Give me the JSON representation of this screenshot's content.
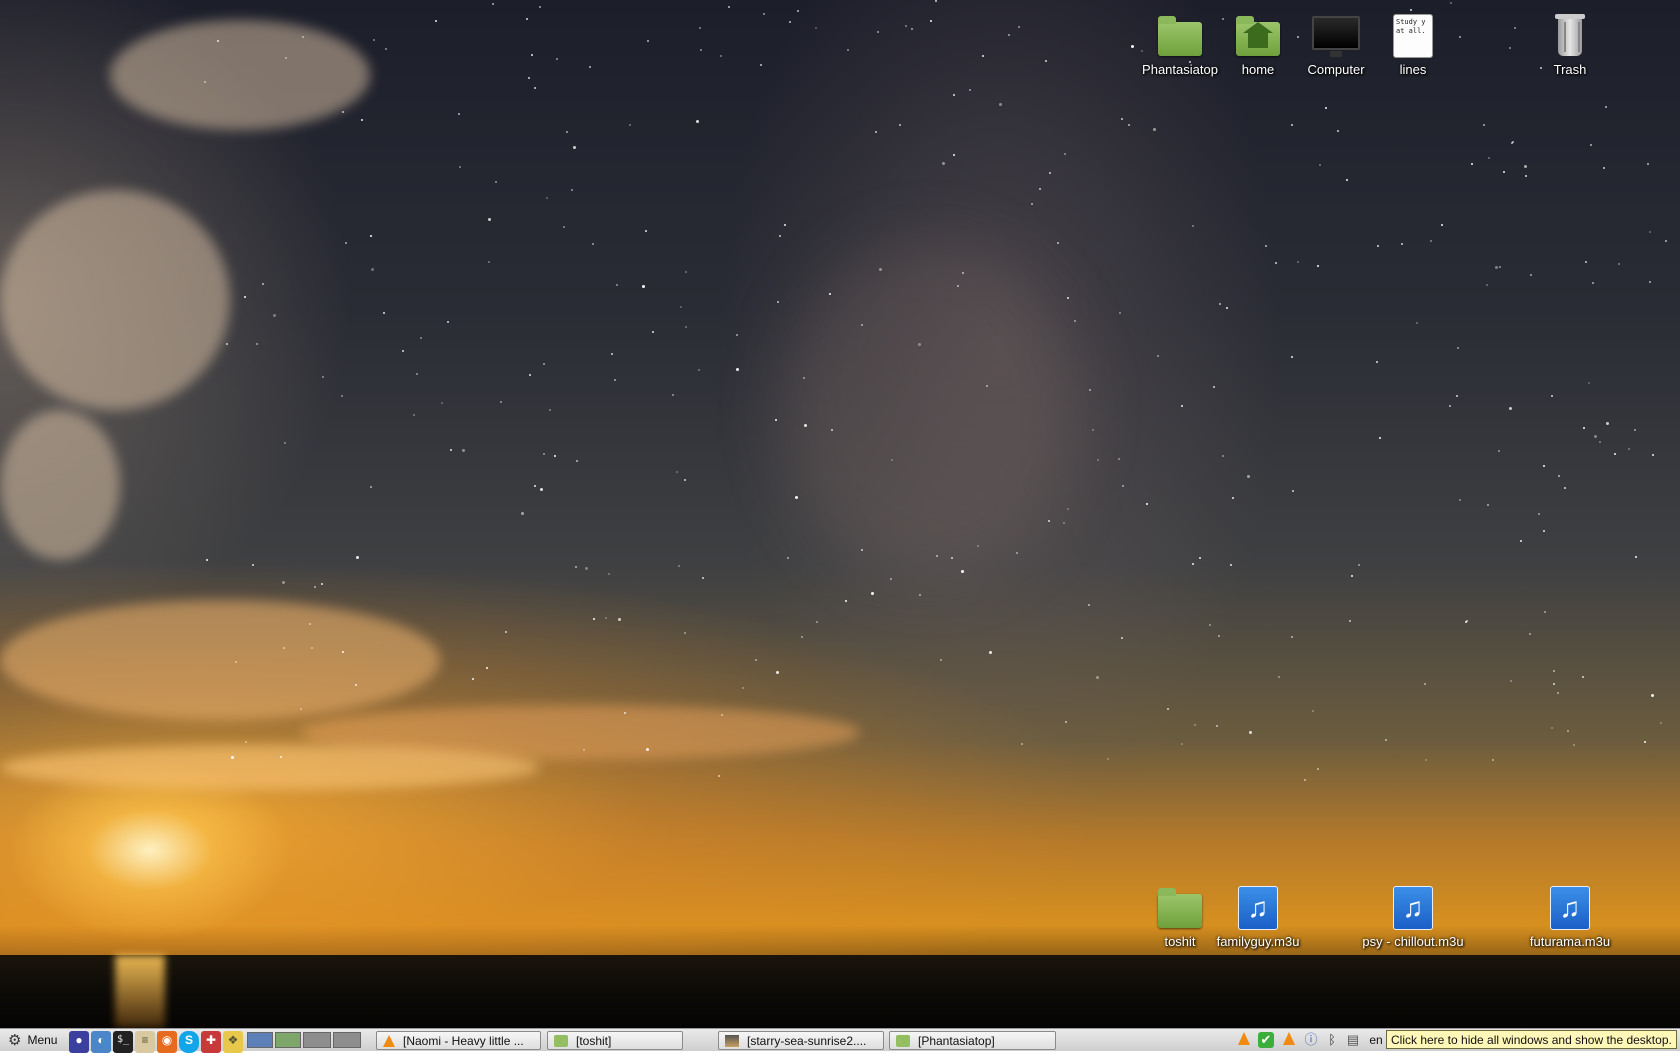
{
  "desktop": {
    "icons_top": [
      {
        "label": "Phantasiatop",
        "icon": "folder-icon"
      },
      {
        "label": "home",
        "icon": "home-folder-icon"
      },
      {
        "label": "Computer",
        "icon": "computer-icon"
      },
      {
        "label": "lines",
        "icon": "text-file-icon",
        "preview": "Study y\nat all."
      },
      {
        "label": "Trash",
        "icon": "trash-icon"
      }
    ],
    "icons_bottom": [
      {
        "label": "toshit",
        "icon": "folder-icon"
      },
      {
        "label": "familyguy.m3u",
        "icon": "music-playlist-icon"
      },
      {
        "label": "psy - chillout.m3u",
        "icon": "music-playlist-icon"
      },
      {
        "label": "futurama.m3u",
        "icon": "music-playlist-icon"
      }
    ]
  },
  "taskbar": {
    "menu_label": "Menu",
    "tasks": [
      {
        "label": "[Naomi - Heavy little ...",
        "icon": "vlc-icon"
      },
      {
        "label": "[toshit]",
        "icon": "folder-icon"
      },
      {
        "label": "[starry-sea-sunrise2....",
        "icon": "image-icon"
      },
      {
        "label": "[Phantasiatop]",
        "icon": "folder-icon"
      }
    ],
    "keyboard_layout": "en",
    "show_desktop_tooltip": "Click here to hide all windows and show the desktop."
  }
}
